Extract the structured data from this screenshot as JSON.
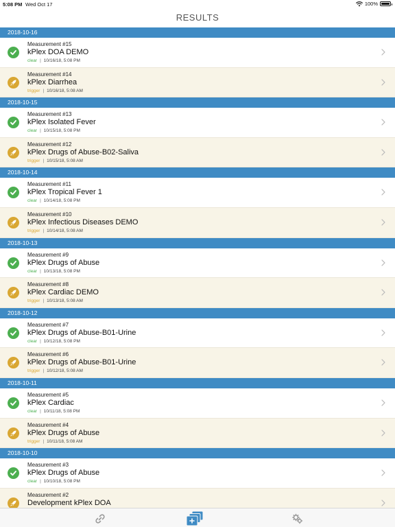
{
  "status_bar": {
    "time": "5:08 PM",
    "date": "Wed Oct 17",
    "battery": "100%"
  },
  "nav": {
    "title": "RESULTS"
  },
  "sections": [
    {
      "date": "2018-10-16",
      "items": [
        {
          "measurement": "Measurement #15",
          "name": "kPlex DOA DEMO",
          "status": "clear",
          "timestamp": "10/16/18, 5:08 PM"
        },
        {
          "measurement": "Measurement #14",
          "name": "kPlex Diarrhea",
          "status": "trigger",
          "timestamp": "10/16/18, 5:08 AM"
        }
      ]
    },
    {
      "date": "2018-10-15",
      "items": [
        {
          "measurement": "Measurement #13",
          "name": "kPlex Isolated Fever",
          "status": "clear",
          "timestamp": "10/15/18, 5:08 PM"
        },
        {
          "measurement": "Measurement #12",
          "name": "kPlex Drugs of Abuse-B02-Saliva",
          "status": "trigger",
          "timestamp": "10/15/18, 5:08 AM"
        }
      ]
    },
    {
      "date": "2018-10-14",
      "items": [
        {
          "measurement": "Measurement #11",
          "name": "kPlex Tropical Fever 1",
          "status": "clear",
          "timestamp": "10/14/18, 5:08 PM"
        },
        {
          "measurement": "Measurement #10",
          "name": "kPlex Infectious Diseases DEMO",
          "status": "trigger",
          "timestamp": "10/14/18, 5:08 AM"
        }
      ]
    },
    {
      "date": "2018-10-13",
      "items": [
        {
          "measurement": "Measurement #9",
          "name": "kPlex Drugs of Abuse",
          "status": "clear",
          "timestamp": "10/13/18, 5:08 PM"
        },
        {
          "measurement": "Measurement #8",
          "name": "kPlex Cardiac DEMO",
          "status": "trigger",
          "timestamp": "10/13/18, 5:08 AM"
        }
      ]
    },
    {
      "date": "2018-10-12",
      "items": [
        {
          "measurement": "Measurement #7",
          "name": "kPlex Drugs of Abuse-B01-Urine",
          "status": "clear",
          "timestamp": "10/12/18, 5:08 PM"
        },
        {
          "measurement": "Measurement #6",
          "name": "kPlex Drugs of Abuse-B01-Urine",
          "status": "trigger",
          "timestamp": "10/12/18, 5:08 AM"
        }
      ]
    },
    {
      "date": "2018-10-11",
      "items": [
        {
          "measurement": "Measurement #5",
          "name": "kPlex Cardiac",
          "status": "clear",
          "timestamp": "10/11/18, 5:08 PM"
        },
        {
          "measurement": "Measurement #4",
          "name": "kPlex Drugs of Abuse",
          "status": "trigger",
          "timestamp": "10/11/18, 5:08 AM"
        }
      ]
    },
    {
      "date": "2018-10-10",
      "items": [
        {
          "measurement": "Measurement #3",
          "name": "kPlex Drugs of Abuse",
          "status": "clear",
          "timestamp": "10/10/18, 5:08 PM"
        },
        {
          "measurement": "Measurement #2",
          "name": "Development kPlex DOA",
          "status": "trigger",
          "timestamp": ""
        }
      ]
    }
  ],
  "tab_bar": {
    "tabs": [
      {
        "id": "link",
        "icon": "link-icon",
        "selected": false
      },
      {
        "id": "results",
        "icon": "results-stack-icon",
        "selected": true
      },
      {
        "id": "settings",
        "icon": "gears-icon",
        "selected": false
      }
    ]
  },
  "colors": {
    "section_header": "#3f8bc4",
    "clear": "#4caf50",
    "trigger": "#d9a733",
    "trigger_row_bg": "#f8f4e7",
    "tab_selected": "#3f8bc4",
    "tab_unselected": "#9a9a9a"
  }
}
